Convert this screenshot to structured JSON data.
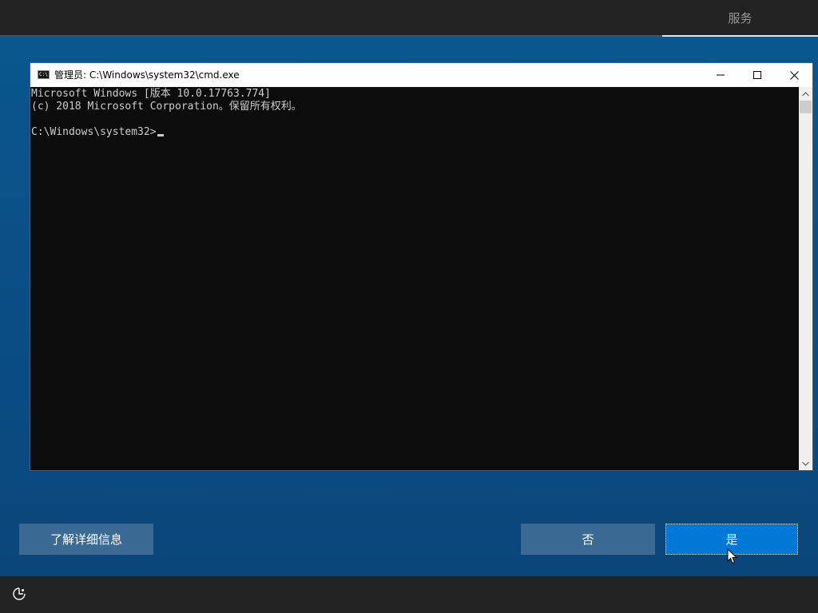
{
  "header": {
    "tab_label": "服务"
  },
  "cmd_window": {
    "title": "管理员: C:\\Windows\\system32\\cmd.exe",
    "icon_text": "C:\\",
    "console_lines": [
      "Microsoft Windows [版本 10.0.17763.774]",
      "(c) 2018 Microsoft Corporation。保留所有权利。",
      "",
      "C:\\Windows\\system32>"
    ]
  },
  "buttons": {
    "learn_more": "了解详细信息",
    "no": "否",
    "yes": "是"
  },
  "icons": {
    "window_icon": "cmd-app-icon",
    "minimize": "minimize-icon",
    "maximize": "maximize-icon",
    "close": "close-icon",
    "scroll_up": "chevron-up-icon",
    "scroll_down": "chevron-down-icon",
    "accessibility": "ease-of-access-icon"
  },
  "colors": {
    "background": "#0a4f85",
    "console_bg": "#0c0c0c",
    "console_text": "#cccccc",
    "primary_button": "#0078d7",
    "secondary_button": "#3b6b95",
    "bars": "#222222"
  }
}
